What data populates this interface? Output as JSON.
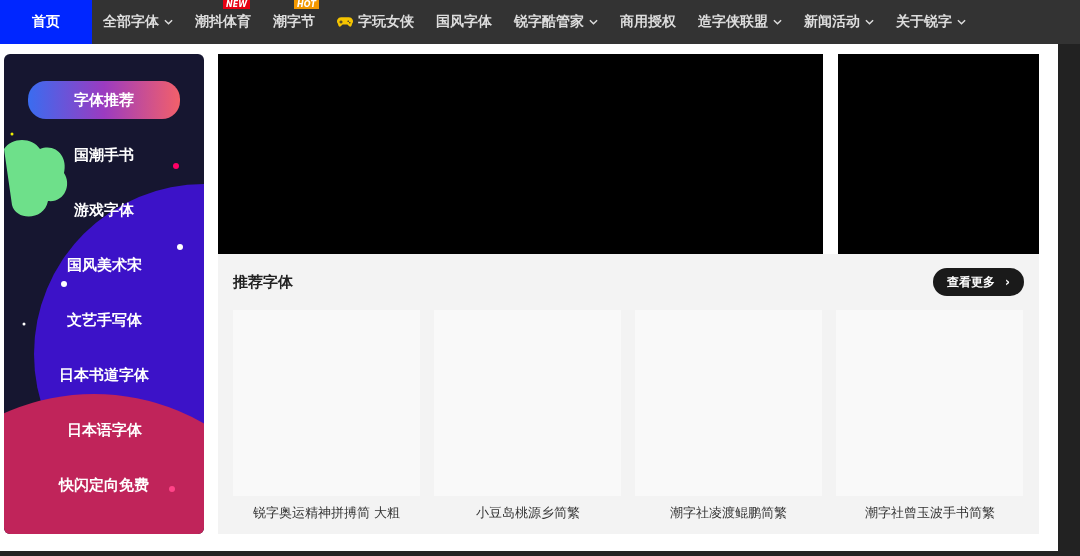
{
  "nav": [
    {
      "label": "首页",
      "selected": true,
      "dropdown": false
    },
    {
      "label": "全部字体",
      "selected": false,
      "dropdown": true
    },
    {
      "label": "潮抖体育",
      "selected": false,
      "dropdown": false,
      "badge": "NEW",
      "color": "#e60012"
    },
    {
      "label": "潮字节",
      "selected": false,
      "dropdown": false,
      "badge": "HOT",
      "color": "#f39800"
    },
    {
      "label": "字玩女侠",
      "selected": false,
      "dropdown": false,
      "kind": "icon"
    },
    {
      "label": "国风字体",
      "selected": false,
      "dropdown": false
    },
    {
      "label": "锐字酷管家",
      "selected": false,
      "dropdown": true
    },
    {
      "label": "商用授权",
      "selected": false,
      "dropdown": false
    },
    {
      "label": "造字侠联盟",
      "selected": false,
      "dropdown": true
    },
    {
      "label": "新闻活动",
      "selected": false,
      "dropdown": true
    },
    {
      "label": "关于锐字",
      "selected": false,
      "dropdown": true
    }
  ],
  "sidebar": {
    "items": [
      {
        "label": "字体推荐",
        "selected": true
      },
      {
        "label": "国潮手书",
        "selected": false
      },
      {
        "label": "游戏字体",
        "selected": false
      },
      {
        "label": "国风美术宋",
        "selected": false
      },
      {
        "label": "文艺手写体",
        "selected": false
      },
      {
        "label": "日本书道字体",
        "selected": false
      },
      {
        "label": "日本语字体",
        "selected": false
      },
      {
        "label": "快闪定向免费",
        "selected": false
      }
    ]
  },
  "section": {
    "title": "推荐字体",
    "more_button": "查看更多",
    "more_arrow": "›",
    "fonts": [
      {
        "name": "锐字奥运精神拼搏简 大粗"
      },
      {
        "name": "小豆岛桃源乡简繁"
      },
      {
        "name": "潮字社凌渡鲲鹏简繁"
      },
      {
        "name": "潮字社曾玉波手书简繁"
      }
    ]
  }
}
